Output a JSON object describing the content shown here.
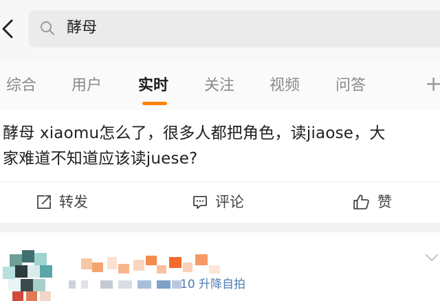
{
  "search": {
    "query": "酵母"
  },
  "tabs": [
    {
      "label": "综合"
    },
    {
      "label": "用户"
    },
    {
      "label": "实时"
    },
    {
      "label": "关注"
    },
    {
      "label": "视频"
    },
    {
      "label": "问答"
    }
  ],
  "active_tab": "实时",
  "post": {
    "line1": "酵母 xiaomu怎么了，很多人都把角色，读jiaose，大",
    "line2": "家难道不知道应该读juese?"
  },
  "actions": {
    "repost": "转发",
    "comment": "评论",
    "like": "赞"
  },
  "next_card": {
    "meta_visible": "10 升降自拍"
  },
  "colors": {
    "accent": "#ff8200",
    "meta_link": "#4d7ab3"
  }
}
